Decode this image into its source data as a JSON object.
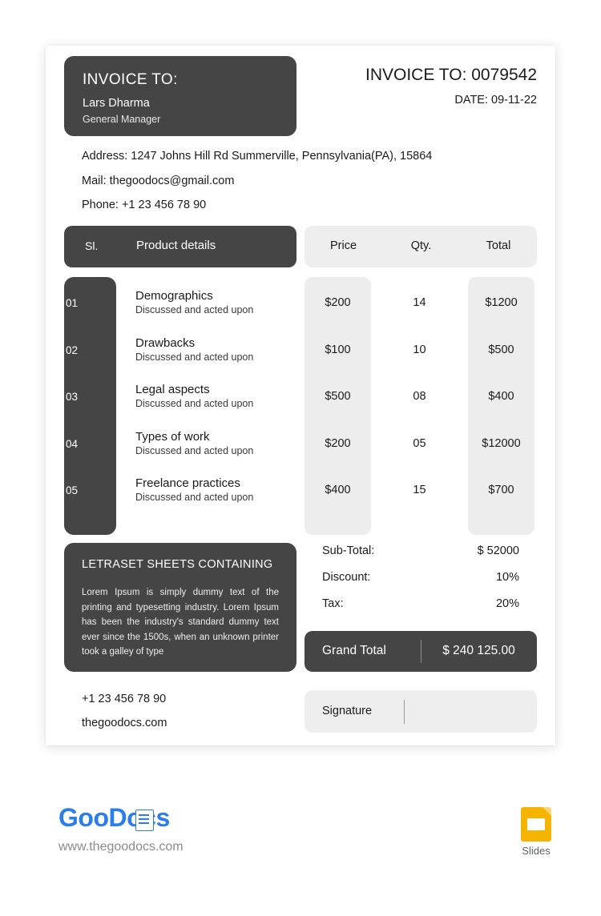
{
  "header": {
    "bill_to_title": "INVOICE TO:",
    "client_name": "Lars Dharma",
    "client_role": "General Manager",
    "invoice_number_line": "INVOICE TO: 0079542",
    "date_line": "DATE: 09-11-22"
  },
  "contact": {
    "address": "Address: 1247 Johns Hill Rd Summerville, Pennsylvania(PA), 15864",
    "mail": "Mail: thegoodocs@gmail.com",
    "phone": "Phone: +1 23 456 78 90"
  },
  "table": {
    "columns": {
      "sl": "Sl.",
      "product": "Product details",
      "price": "Price",
      "qty": "Qty.",
      "total": "Total"
    },
    "rows": [
      {
        "sl": "01",
        "name": "Demographics",
        "desc": "Discussed and acted upon",
        "price": "$200",
        "qty": "14",
        "total": "$1200"
      },
      {
        "sl": "02",
        "name": "Drawbacks",
        "desc": "Discussed and acted upon",
        "price": "$100",
        "qty": "10",
        "total": "$500"
      },
      {
        "sl": "03",
        "name": "Legal aspects",
        "desc": "Discussed and acted upon",
        "price": "$500",
        "qty": "08",
        "total": "$400"
      },
      {
        "sl": "04",
        "name": "Types of work",
        "desc": "Discussed and acted upon",
        "price": "$200",
        "qty": "05",
        "total": "$12000"
      },
      {
        "sl": "05",
        "name": "Freelance practices",
        "desc": "Discussed and acted upon",
        "price": "$400",
        "qty": "15",
        "total": "$700"
      }
    ]
  },
  "note": {
    "title": "LETRASET SHEETS CONTAINING",
    "body": "Lorem Ipsum is simply dummy text of the printing and typesetting industry. Lorem Ipsum has been the industry's standard dummy text ever since the 1500s, when an unknown printer took a galley of type"
  },
  "totals": {
    "rows": [
      {
        "label": "Sub-Total:",
        "value": "$ 52000"
      },
      {
        "label": "Discount:",
        "value": "10%"
      },
      {
        "label": "Tax:",
        "value": "20%"
      }
    ],
    "grand_label": "Grand Total",
    "grand_value": "$ 240 125.00"
  },
  "footer": {
    "phone": "+1 23 456 78 90",
    "website": "thegoodocs.com",
    "signature_label": "Signature"
  },
  "brand": {
    "logo_text": "GooDocs",
    "url": "www.thegoodocs.com",
    "slides_label": "Slides"
  },
  "colors": {
    "dark": "#454545",
    "light_gray": "#eeeeee",
    "column_gray": "#ededed",
    "brand_blue": "#2b7de9",
    "slides_amber": "#f4b400",
    "text": "#1a1a1a"
  }
}
